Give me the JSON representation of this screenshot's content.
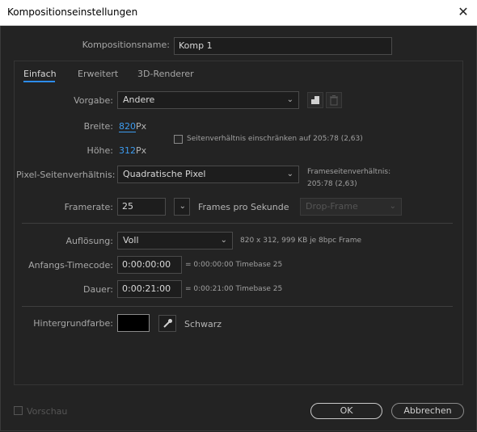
{
  "window": {
    "title": "Kompositionseinstellungen"
  },
  "comp_name": {
    "label": "Kompositionsname:",
    "value": "Komp 1"
  },
  "tabs": [
    {
      "label": "Einfach",
      "active": true
    },
    {
      "label": "Erweitert",
      "active": false
    },
    {
      "label": "3D-Renderer",
      "active": false
    }
  ],
  "preset": {
    "label": "Vorgabe:",
    "value": "Andere"
  },
  "width": {
    "label": "Breite:",
    "value": "820",
    "unit": "Px"
  },
  "height": {
    "label": "Höhe:",
    "value": "312",
    "unit": "Px"
  },
  "lock_aspect": {
    "label": "Seitenverhältnis einschränken auf 205:78 (2,63)",
    "checked": false
  },
  "pixel_aspect": {
    "label": "Pixel-Seitenverhältnis:",
    "value": "Quadratische Pixel"
  },
  "frame_aspect": {
    "label": "Frameseitenverhältnis:",
    "value": "205:78 (2,63)"
  },
  "framerate": {
    "label": "Framerate:",
    "value": "25",
    "unit": "Frames pro Sekunde",
    "drop_frame": "Drop-Frame"
  },
  "resolution": {
    "label": "Auflösung:",
    "value": "Voll",
    "info": "820 x 312, 999 KB je 8bpc Frame"
  },
  "start_timecode": {
    "label": "Anfangs-Timecode:",
    "value": "0:00:00:00",
    "info": "= 0:00:00:00  Timebase 25"
  },
  "duration": {
    "label": "Dauer:",
    "value": "0:00:21:00",
    "info": "= 0:00:21:00  Timebase 25"
  },
  "background": {
    "label": "Hintergrundfarbe:",
    "color": "#000000",
    "name": "Schwarz"
  },
  "preview": {
    "label": "Vorschau",
    "checked": false
  },
  "buttons": {
    "ok": "OK",
    "cancel": "Abbrechen"
  },
  "colors": {
    "accent": "#2d8ceb",
    "link": "#3d9cf0",
    "background": "#232323"
  }
}
